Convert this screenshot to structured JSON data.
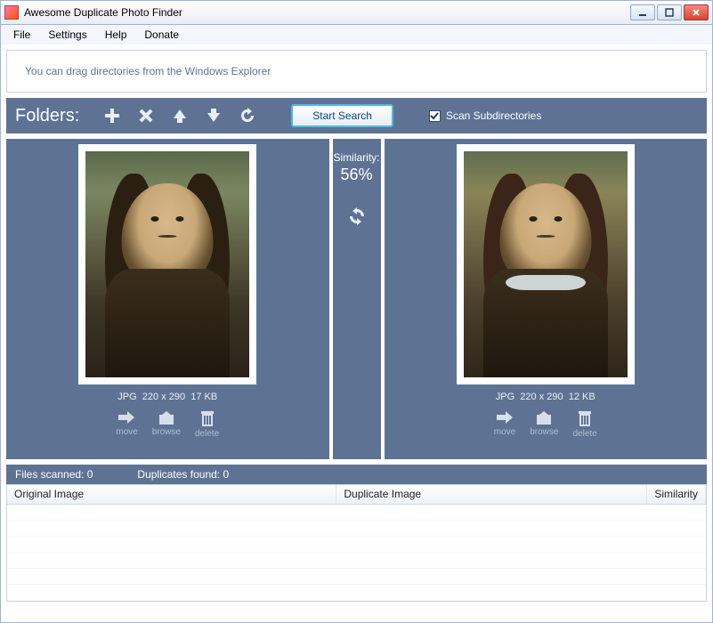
{
  "window": {
    "title": "Awesome Duplicate Photo Finder"
  },
  "menu": {
    "file": "File",
    "settings": "Settings",
    "help": "Help",
    "donate": "Donate"
  },
  "hint": "You can drag directories from the Windows Explorer",
  "toolbar": {
    "folders_label": "Folders:",
    "start_search": "Start Search",
    "scan_subdirs_label": "Scan Subdirectories",
    "scan_subdirs_checked": true
  },
  "compare": {
    "similarity_label": "Similarity:",
    "similarity_value": "56%",
    "left": {
      "format": "JPG",
      "dimensions": "220 x 290",
      "size": "17 KB",
      "move": "move",
      "browse": "browse",
      "delete": "delete"
    },
    "right": {
      "format": "JPG",
      "dimensions": "220 x 290",
      "size": "12 KB",
      "move": "move",
      "browse": "browse",
      "delete": "delete"
    }
  },
  "status": {
    "files_scanned_label": "Files scanned:",
    "files_scanned": "0",
    "duplicates_found_label": "Duplicates found:",
    "duplicates_found": "0"
  },
  "results": {
    "headers": {
      "original": "Original Image",
      "duplicate": "Duplicate Image",
      "similarity": "Similarity"
    },
    "rows": []
  }
}
